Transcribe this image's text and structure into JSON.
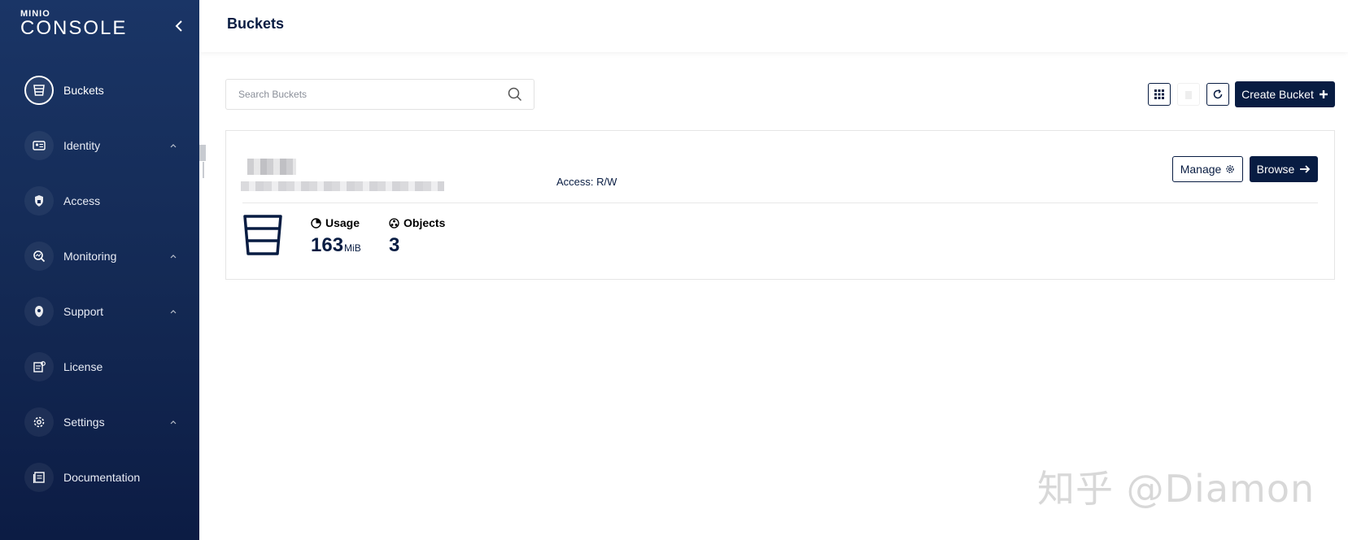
{
  "sidebar": {
    "logo_top": "MINIO",
    "logo_main": "CONSOLE",
    "items": [
      {
        "label": "Buckets",
        "icon": "bucket-icon",
        "active": true,
        "expandable": false
      },
      {
        "label": "Identity",
        "icon": "id-card-icon",
        "active": false,
        "expandable": true
      },
      {
        "label": "Access",
        "icon": "lock-icon",
        "active": false,
        "expandable": false
      },
      {
        "label": "Monitoring",
        "icon": "monitor-search-icon",
        "active": false,
        "expandable": true
      },
      {
        "label": "Support",
        "icon": "support-icon",
        "active": false,
        "expandable": true
      },
      {
        "label": "License",
        "icon": "license-icon",
        "active": false,
        "expandable": false
      },
      {
        "label": "Settings",
        "icon": "gear-icon",
        "active": false,
        "expandable": true
      },
      {
        "label": "Documentation",
        "icon": "document-icon",
        "active": false,
        "expandable": false
      }
    ]
  },
  "header": {
    "title": "Buckets"
  },
  "toolbar": {
    "search_placeholder": "Search Buckets",
    "create_label": "Create Bucket"
  },
  "bucket": {
    "access": "Access: R/W",
    "manage_label": "Manage",
    "browse_label": "Browse",
    "usage_label": "Usage",
    "usage_value": "163",
    "usage_unit": "MiB",
    "objects_label": "Objects",
    "objects_value": "3"
  },
  "watermark": "知乎 @Diamon",
  "colors": {
    "primary": "#081c42",
    "sidebar_top": "#1a3566",
    "sidebar_bottom": "#0c1c44"
  }
}
